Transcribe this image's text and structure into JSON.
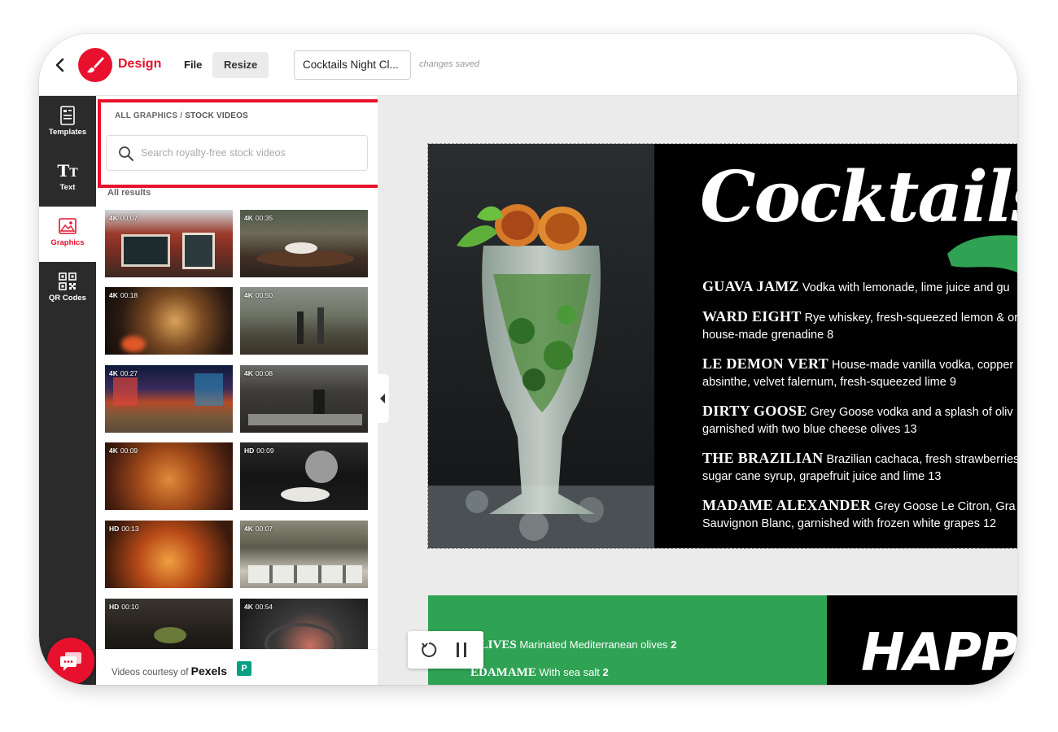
{
  "app": {
    "brand": "Design",
    "menu_file": "File",
    "menu_resize": "Resize",
    "doc_title": "Cocktails Night Cl...",
    "save_status": "changes saved",
    "accent_color": "#e8112d"
  },
  "nav": {
    "items": [
      {
        "label": "Templates",
        "icon": "templates-icon"
      },
      {
        "label": "Text",
        "icon": "text-icon"
      },
      {
        "label": "Graphics",
        "icon": "graphics-icon"
      },
      {
        "label": "QR Codes",
        "icon": "qr-code-icon"
      }
    ],
    "active": "Graphics"
  },
  "panel": {
    "crumb_root": "ALL GRAPHICS",
    "crumb_sep": "/",
    "crumb_current": "STOCK VIDEOS",
    "search_placeholder": "Search royalty-free stock videos",
    "results_label": "All results",
    "videos": [
      {
        "quality": "4K",
        "duration": "00:07"
      },
      {
        "quality": "4K",
        "duration": "00:35"
      },
      {
        "quality": "4K",
        "duration": "00:18"
      },
      {
        "quality": "4K",
        "duration": "00:50"
      },
      {
        "quality": "4K",
        "duration": "00:27"
      },
      {
        "quality": "4K",
        "duration": "00:08"
      },
      {
        "quality": "4K",
        "duration": "00:09"
      },
      {
        "quality": "HD",
        "duration": "00:09"
      },
      {
        "quality": "HD",
        "duration": "00:13"
      },
      {
        "quality": "4K",
        "duration": "00:07"
      },
      {
        "quality": "HD",
        "duration": "00:10"
      },
      {
        "quality": "4K",
        "duration": "00:54"
      }
    ],
    "courtesy_text": "Videos courtesy of",
    "courtesy_brand": "Pexels",
    "courtesy_logo": "P"
  },
  "canvas": {
    "menu_title": "Cocktails",
    "drinks": [
      {
        "name": "GUAVA JAMZ",
        "line1": "Vodka with lemonade, lime juice and gu",
        "line2": ""
      },
      {
        "name": "WARD EIGHT",
        "line1": "Rye whiskey, fresh-squeezed lemon & or",
        "line2": "house-made grenadine 8"
      },
      {
        "name": "LE DEMON VERT",
        "line1": "House-made vanilla vodka, copper",
        "line2": "absinthe, velvet falernum, fresh-squeezed lime 9"
      },
      {
        "name": "DIRTY GOOSE",
        "line1": "Grey Goose vodka and a splash of oliv",
        "line2": "garnished with two blue cheese olives 13"
      },
      {
        "name": "THE BRAZILIAN",
        "line1": "Brazilian cachaca, fresh strawberries",
        "line2": "sugar cane syrup, grapefruit juice and lime 13"
      },
      {
        "name": "MADAME ALEXANDER",
        "line1": "Grey Goose Le Citron, Gra",
        "line2": "Sauvignon Blanc, garnished with frozen white grapes 12"
      }
    ],
    "snacks": [
      {
        "name": "OLIVES",
        "desc": "Marinated Mediterranean olives",
        "price": "2"
      },
      {
        "name": "EDAMAME",
        "desc": "With sea salt",
        "price": "2"
      }
    ],
    "happy_text": "HAPPY",
    "green": "#2fa254"
  }
}
